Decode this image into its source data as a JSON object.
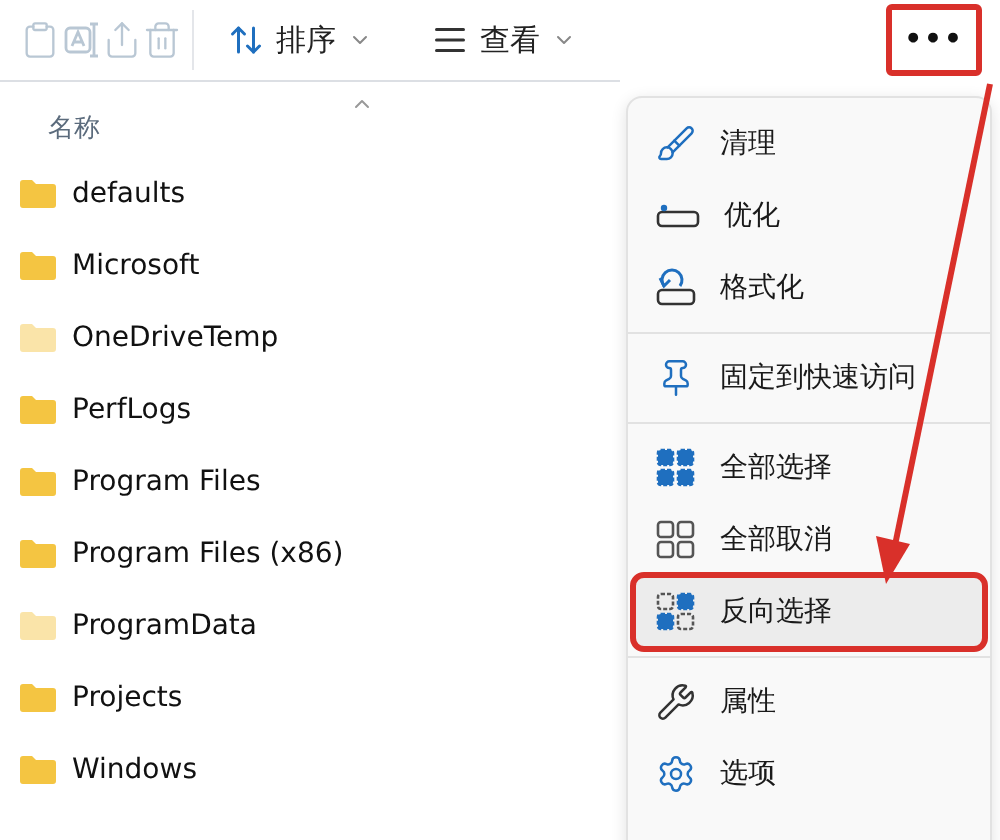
{
  "toolbar": {
    "actions": [
      {
        "kind": "paste",
        "disabled": true
      },
      {
        "kind": "rename",
        "disabled": true
      },
      {
        "kind": "share",
        "disabled": true
      },
      {
        "kind": "delete",
        "disabled": true
      }
    ],
    "sort": {
      "label": "排序"
    },
    "view": {
      "label": "查看"
    },
    "more": {
      "label": "•••",
      "highlighted": true
    }
  },
  "file_list": {
    "column": "名称",
    "folders": [
      {
        "name": "defaults",
        "hidden": false
      },
      {
        "name": "Microsoft",
        "hidden": false
      },
      {
        "name": "OneDriveTemp",
        "hidden": true
      },
      {
        "name": "PerfLogs",
        "hidden": false
      },
      {
        "name": "Program Files",
        "hidden": false
      },
      {
        "name": "Program Files (x86)",
        "hidden": false
      },
      {
        "name": "ProgramData",
        "hidden": true
      },
      {
        "name": "Projects",
        "hidden": false
      },
      {
        "name": "Windows",
        "hidden": false
      }
    ]
  },
  "menu": {
    "groups": [
      [
        {
          "kind": "cleanup",
          "label": "清理",
          "selected": false,
          "highlighted": false
        },
        {
          "kind": "optimize",
          "label": "优化",
          "selected": false,
          "highlighted": false
        },
        {
          "kind": "format",
          "label": "格式化",
          "selected": false,
          "highlighted": false
        }
      ],
      [
        {
          "kind": "pin",
          "label": "固定到快速访问",
          "selected": false,
          "highlighted": false
        }
      ],
      [
        {
          "kind": "select-all",
          "label": "全部选择",
          "selected": false,
          "highlighted": false
        },
        {
          "kind": "select-none",
          "label": "全部取消",
          "selected": false,
          "highlighted": false
        },
        {
          "kind": "invert",
          "label": "反向选择",
          "selected": true,
          "highlighted": true
        }
      ],
      [
        {
          "kind": "properties",
          "label": "属性",
          "selected": false,
          "highlighted": false
        },
        {
          "kind": "options",
          "label": "选项",
          "selected": false,
          "highlighted": false
        }
      ]
    ]
  },
  "annotation": {
    "arrow": true
  }
}
